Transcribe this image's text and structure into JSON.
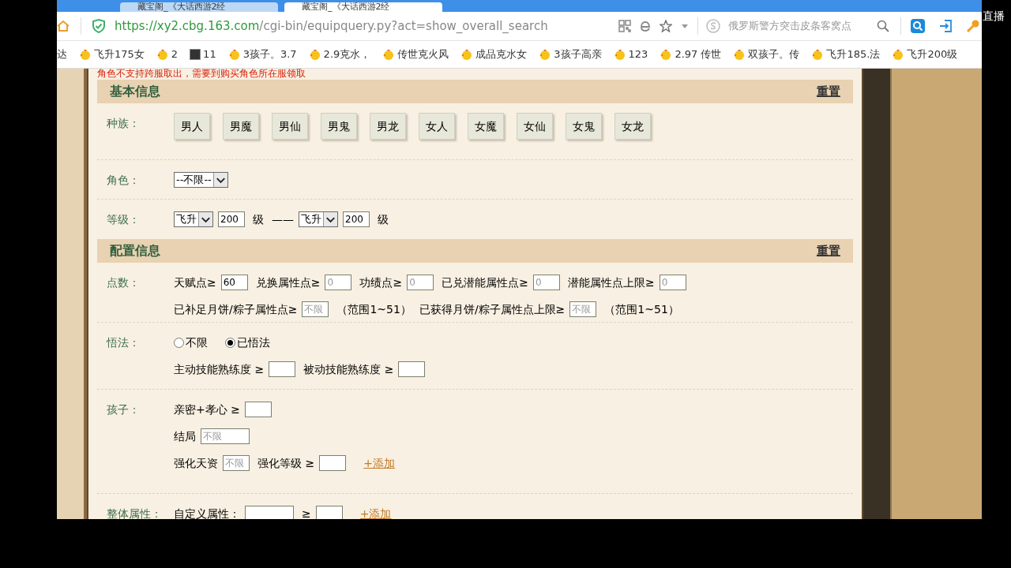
{
  "browser": {
    "tabs": [
      {
        "title": "藏宝阁_《大话西游2经",
        "selected": false
      },
      {
        "title": "藏宝阁_《大话西游2经",
        "selected": true
      }
    ],
    "url_host": "https://xy2.cbg.163.com",
    "url_path": "/cgi-bin/equipquery.py?act=show_overall_search",
    "search_placeholder": "俄罗斯警方突击皮条客窝点",
    "bookmarks": [
      {
        "label": "达",
        "kind": "text"
      },
      {
        "label": "飞升175女",
        "kind": "chick"
      },
      {
        "label": "2",
        "kind": "chick"
      },
      {
        "label": "11",
        "kind": "dark"
      },
      {
        "label": "3孩子。3.7",
        "kind": "chick"
      },
      {
        "label": "2.9克水，",
        "kind": "chick"
      },
      {
        "label": "传世克火风",
        "kind": "chick"
      },
      {
        "label": "成品克水女",
        "kind": "chick"
      },
      {
        "label": "3孩子高亲",
        "kind": "chick"
      },
      {
        "label": "123",
        "kind": "chick"
      },
      {
        "label": "2.97 传世",
        "kind": "chick"
      },
      {
        "label": "双孩子。传",
        "kind": "chick"
      },
      {
        "label": "飞升185.法",
        "kind": "chick"
      },
      {
        "label": "飞升200级",
        "kind": "chick"
      }
    ]
  },
  "overlay_label": "直播",
  "notice": "角色不支持跨服取出，需要到购买角色所在服领取",
  "sections": [
    {
      "title": "基本信息",
      "reset": "重置",
      "rows": [
        {
          "label": "种族：",
          "lines": [
            [
              {
                "kind": "toggle",
                "label": "男人",
                "selected": false
              },
              {
                "kind": "toggle",
                "label": "男魔",
                "selected": false
              },
              {
                "kind": "toggle",
                "label": "男仙",
                "selected": false
              },
              {
                "kind": "toggle",
                "label": "男鬼",
                "selected": false
              },
              {
                "kind": "toggle",
                "label": "男龙",
                "selected": false
              },
              {
                "kind": "toggle",
                "label": "女人",
                "selected": false
              },
              {
                "kind": "toggle",
                "label": "女魔",
                "selected": false
              },
              {
                "kind": "toggle",
                "label": "女仙",
                "selected": false
              },
              {
                "kind": "toggle",
                "label": "女鬼",
                "selected": false
              },
              {
                "kind": "toggle",
                "label": "女龙",
                "selected": false
              }
            ]
          ]
        },
        {
          "label": "角色：",
          "lines": [
            [
              {
                "kind": "select",
                "value": "--不限--"
              }
            ]
          ]
        },
        {
          "label": "等级：",
          "lines": [
            [
              {
                "kind": "select",
                "value": "飞升"
              },
              {
                "kind": "input",
                "value": "200"
              },
              {
                "kind": "text",
                "text": "级"
              },
              {
                "kind": "text",
                "text": "——"
              },
              {
                "kind": "select",
                "value": "飞升"
              },
              {
                "kind": "input",
                "value": "200"
              },
              {
                "kind": "text",
                "text": "级"
              }
            ]
          ]
        }
      ]
    },
    {
      "title": "配置信息",
      "reset": "重置",
      "rows": [
        {
          "label": "点数：",
          "lines": [
            [
              {
                "kind": "text",
                "text": "天赋点≥"
              },
              {
                "kind": "input",
                "value": "60"
              },
              {
                "kind": "text",
                "text": "兑换属性点≥"
              },
              {
                "kind": "input",
                "placeholder": "0"
              },
              {
                "kind": "text",
                "text": "功绩点≥"
              },
              {
                "kind": "input",
                "placeholder": "0"
              },
              {
                "kind": "text",
                "text": "已兑潜能属性点≥"
              },
              {
                "kind": "input",
                "placeholder": "0"
              },
              {
                "kind": "text",
                "text": "潜能属性点上限≥"
              },
              {
                "kind": "input",
                "placeholder": "0"
              }
            ],
            [
              {
                "kind": "text",
                "text": "已补足月饼/粽子属性点≥"
              },
              {
                "kind": "input",
                "placeholder": "不限"
              },
              {
                "kind": "text",
                "text": "（范围1~51）"
              },
              {
                "kind": "text",
                "text": "已获得月饼/粽子属性点上限≥"
              },
              {
                "kind": "input",
                "placeholder": "不限"
              },
              {
                "kind": "text",
                "text": "（范围1~51）"
              }
            ]
          ]
        },
        {
          "label": "悟法：",
          "lines": [
            [
              {
                "kind": "radio",
                "label": "不限",
                "selected": false
              },
              {
                "kind": "radio",
                "label": "已悟法",
                "selected": true
              }
            ],
            [
              {
                "kind": "text",
                "text": "主动技能熟练度 ≥"
              },
              {
                "kind": "input"
              },
              {
                "kind": "text",
                "text": "被动技能熟练度 ≥"
              },
              {
                "kind": "input"
              }
            ]
          ]
        },
        {
          "label": "孩子：",
          "lines": [
            [
              {
                "kind": "text",
                "text": "亲密+孝心 ≥"
              },
              {
                "kind": "input"
              }
            ],
            [
              {
                "kind": "text",
                "text": "结局"
              },
              {
                "kind": "input",
                "placeholder": "不限",
                "wide": true
              }
            ],
            [
              {
                "kind": "text",
                "text": "强化天资"
              },
              {
                "kind": "input",
                "placeholder": "不限"
              },
              {
                "kind": "text",
                "text": "强化等级 ≥"
              },
              {
                "kind": "input"
              },
              {
                "kind": "link",
                "text": "+添加"
              }
            ]
          ]
        },
        {
          "label": "整体属性：",
          "lines": [
            [
              {
                "kind": "text",
                "text": "自定义属性："
              },
              {
                "kind": "input",
                "wide": true
              },
              {
                "kind": "text",
                "text": "≥"
              },
              {
                "kind": "input"
              },
              {
                "kind": "link",
                "text": "+添加"
              }
            ]
          ]
        }
      ]
    }
  ]
}
